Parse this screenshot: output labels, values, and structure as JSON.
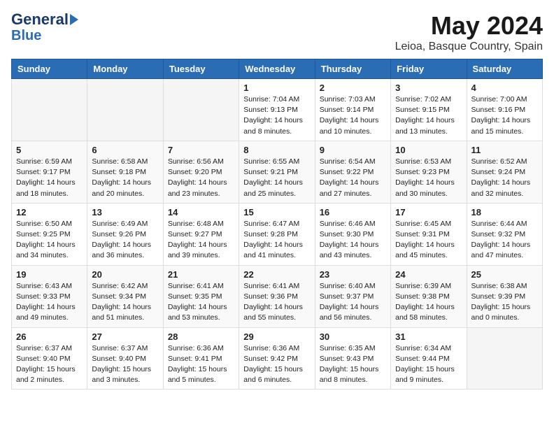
{
  "header": {
    "logo_line1": "General",
    "logo_line2": "Blue",
    "title": "May 2024",
    "subtitle": "Leioa, Basque Country, Spain"
  },
  "weekdays": [
    "Sunday",
    "Monday",
    "Tuesday",
    "Wednesday",
    "Thursday",
    "Friday",
    "Saturday"
  ],
  "weeks": [
    [
      {
        "day": "",
        "empty": true
      },
      {
        "day": "",
        "empty": true
      },
      {
        "day": "",
        "empty": true
      },
      {
        "day": "1",
        "sunrise": "Sunrise: 7:04 AM",
        "sunset": "Sunset: 9:13 PM",
        "daylight": "Daylight: 14 hours and 8 minutes."
      },
      {
        "day": "2",
        "sunrise": "Sunrise: 7:03 AM",
        "sunset": "Sunset: 9:14 PM",
        "daylight": "Daylight: 14 hours and 10 minutes."
      },
      {
        "day": "3",
        "sunrise": "Sunrise: 7:02 AM",
        "sunset": "Sunset: 9:15 PM",
        "daylight": "Daylight: 14 hours and 13 minutes."
      },
      {
        "day": "4",
        "sunrise": "Sunrise: 7:00 AM",
        "sunset": "Sunset: 9:16 PM",
        "daylight": "Daylight: 14 hours and 15 minutes."
      }
    ],
    [
      {
        "day": "5",
        "sunrise": "Sunrise: 6:59 AM",
        "sunset": "Sunset: 9:17 PM",
        "daylight": "Daylight: 14 hours and 18 minutes."
      },
      {
        "day": "6",
        "sunrise": "Sunrise: 6:58 AM",
        "sunset": "Sunset: 9:18 PM",
        "daylight": "Daylight: 14 hours and 20 minutes."
      },
      {
        "day": "7",
        "sunrise": "Sunrise: 6:56 AM",
        "sunset": "Sunset: 9:20 PM",
        "daylight": "Daylight: 14 hours and 23 minutes."
      },
      {
        "day": "8",
        "sunrise": "Sunrise: 6:55 AM",
        "sunset": "Sunset: 9:21 PM",
        "daylight": "Daylight: 14 hours and 25 minutes."
      },
      {
        "day": "9",
        "sunrise": "Sunrise: 6:54 AM",
        "sunset": "Sunset: 9:22 PM",
        "daylight": "Daylight: 14 hours and 27 minutes."
      },
      {
        "day": "10",
        "sunrise": "Sunrise: 6:53 AM",
        "sunset": "Sunset: 9:23 PM",
        "daylight": "Daylight: 14 hours and 30 minutes."
      },
      {
        "day": "11",
        "sunrise": "Sunrise: 6:52 AM",
        "sunset": "Sunset: 9:24 PM",
        "daylight": "Daylight: 14 hours and 32 minutes."
      }
    ],
    [
      {
        "day": "12",
        "sunrise": "Sunrise: 6:50 AM",
        "sunset": "Sunset: 9:25 PM",
        "daylight": "Daylight: 14 hours and 34 minutes."
      },
      {
        "day": "13",
        "sunrise": "Sunrise: 6:49 AM",
        "sunset": "Sunset: 9:26 PM",
        "daylight": "Daylight: 14 hours and 36 minutes."
      },
      {
        "day": "14",
        "sunrise": "Sunrise: 6:48 AM",
        "sunset": "Sunset: 9:27 PM",
        "daylight": "Daylight: 14 hours and 39 minutes."
      },
      {
        "day": "15",
        "sunrise": "Sunrise: 6:47 AM",
        "sunset": "Sunset: 9:28 PM",
        "daylight": "Daylight: 14 hours and 41 minutes."
      },
      {
        "day": "16",
        "sunrise": "Sunrise: 6:46 AM",
        "sunset": "Sunset: 9:30 PM",
        "daylight": "Daylight: 14 hours and 43 minutes."
      },
      {
        "day": "17",
        "sunrise": "Sunrise: 6:45 AM",
        "sunset": "Sunset: 9:31 PM",
        "daylight": "Daylight: 14 hours and 45 minutes."
      },
      {
        "day": "18",
        "sunrise": "Sunrise: 6:44 AM",
        "sunset": "Sunset: 9:32 PM",
        "daylight": "Daylight: 14 hours and 47 minutes."
      }
    ],
    [
      {
        "day": "19",
        "sunrise": "Sunrise: 6:43 AM",
        "sunset": "Sunset: 9:33 PM",
        "daylight": "Daylight: 14 hours and 49 minutes."
      },
      {
        "day": "20",
        "sunrise": "Sunrise: 6:42 AM",
        "sunset": "Sunset: 9:34 PM",
        "daylight": "Daylight: 14 hours and 51 minutes."
      },
      {
        "day": "21",
        "sunrise": "Sunrise: 6:41 AM",
        "sunset": "Sunset: 9:35 PM",
        "daylight": "Daylight: 14 hours and 53 minutes."
      },
      {
        "day": "22",
        "sunrise": "Sunrise: 6:41 AM",
        "sunset": "Sunset: 9:36 PM",
        "daylight": "Daylight: 14 hours and 55 minutes."
      },
      {
        "day": "23",
        "sunrise": "Sunrise: 6:40 AM",
        "sunset": "Sunset: 9:37 PM",
        "daylight": "Daylight: 14 hours and 56 minutes."
      },
      {
        "day": "24",
        "sunrise": "Sunrise: 6:39 AM",
        "sunset": "Sunset: 9:38 PM",
        "daylight": "Daylight: 14 hours and 58 minutes."
      },
      {
        "day": "25",
        "sunrise": "Sunrise: 6:38 AM",
        "sunset": "Sunset: 9:39 PM",
        "daylight": "Daylight: 15 hours and 0 minutes."
      }
    ],
    [
      {
        "day": "26",
        "sunrise": "Sunrise: 6:37 AM",
        "sunset": "Sunset: 9:40 PM",
        "daylight": "Daylight: 15 hours and 2 minutes."
      },
      {
        "day": "27",
        "sunrise": "Sunrise: 6:37 AM",
        "sunset": "Sunset: 9:40 PM",
        "daylight": "Daylight: 15 hours and 3 minutes."
      },
      {
        "day": "28",
        "sunrise": "Sunrise: 6:36 AM",
        "sunset": "Sunset: 9:41 PM",
        "daylight": "Daylight: 15 hours and 5 minutes."
      },
      {
        "day": "29",
        "sunrise": "Sunrise: 6:36 AM",
        "sunset": "Sunset: 9:42 PM",
        "daylight": "Daylight: 15 hours and 6 minutes."
      },
      {
        "day": "30",
        "sunrise": "Sunrise: 6:35 AM",
        "sunset": "Sunset: 9:43 PM",
        "daylight": "Daylight: 15 hours and 8 minutes."
      },
      {
        "day": "31",
        "sunrise": "Sunrise: 6:34 AM",
        "sunset": "Sunset: 9:44 PM",
        "daylight": "Daylight: 15 hours and 9 minutes."
      },
      {
        "day": "",
        "empty": true
      }
    ]
  ]
}
